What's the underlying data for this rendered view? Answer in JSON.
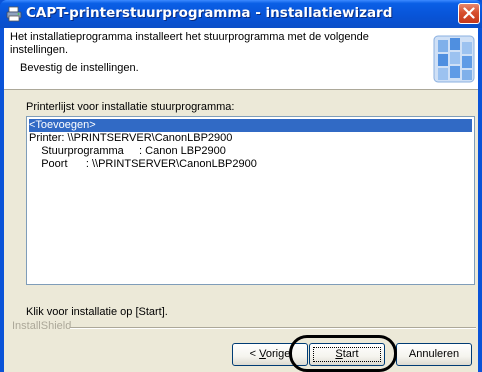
{
  "window": {
    "title": "CAPT-printerstuurprogramma - installatiewizard",
    "icons": {
      "app": "printer-app-icon",
      "close": "close-icon"
    }
  },
  "header": {
    "description": "Het installatieprogramma installeert het stuurprogramma met de volgende instellingen.",
    "subtitle": "Bevestig de instellingen."
  },
  "printer_list": {
    "label": "Printerlijst voor installatie stuurprogramma:",
    "rows": [
      {
        "text": "<Toevoegen>",
        "selected": true
      },
      {
        "text": "Printer: \\\\PRINTSERVER\\CanonLBP2900",
        "selected": false
      },
      {
        "text": "    Stuurprogramma     : Canon LBP2900",
        "selected": false
      },
      {
        "text": "    Poort      : \\\\PRINTSERVER\\CanonLBP2900",
        "selected": false
      }
    ]
  },
  "footer": {
    "instruction": "Klik voor installatie op [Start].",
    "brand": "InstallShield"
  },
  "buttons": {
    "back": {
      "prefix": "< ",
      "mnemonic": "V",
      "rest": "orige"
    },
    "start": {
      "mnemonic": "S",
      "rest": "tart"
    },
    "cancel": "Annuleren"
  },
  "colors": {
    "title_bar": "#0a5fe6",
    "dialog_bg": "#ece9d8",
    "selection": "#316ac5",
    "close_button": "#d7502f"
  }
}
